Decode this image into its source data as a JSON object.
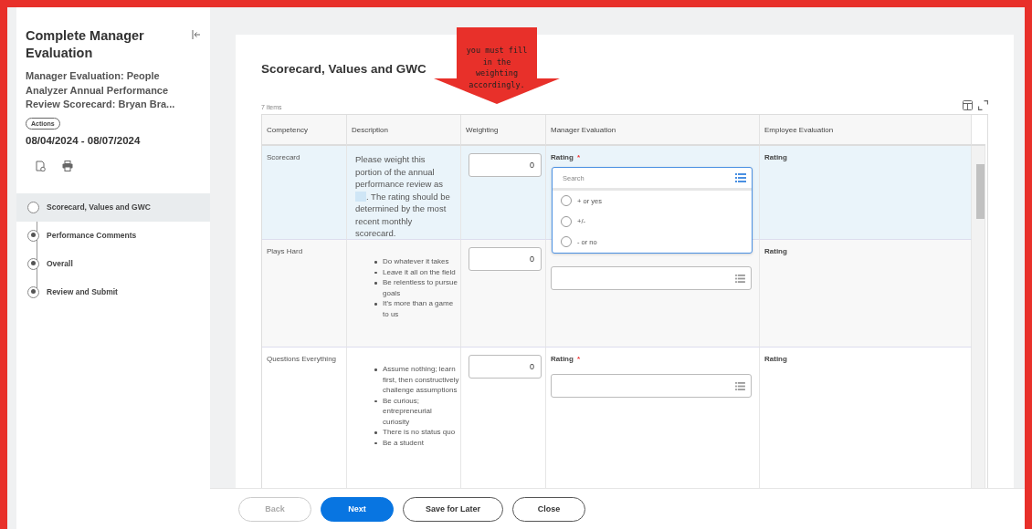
{
  "sidebar": {
    "title": "Complete Manager Evaluation",
    "subtitle": "Manager Evaluation: People Analyzer Annual Performance Review Scorecard: Bryan Bra...",
    "actions_button": "Actions",
    "date_range": "08/04/2024 - 08/07/2024",
    "steps": [
      {
        "label": "Scorecard, Values and GWC",
        "selected": true
      },
      {
        "label": "Performance Comments",
        "selected": false
      },
      {
        "label": "Overall",
        "selected": false
      },
      {
        "label": "Review and Submit",
        "selected": false
      }
    ]
  },
  "card": {
    "title": "Scorecard, Values and GWC",
    "item_count": "7 items",
    "table": {
      "columns": [
        "Competency",
        "Description",
        "Weighting",
        "Manager Evaluation",
        "Employee Evaluation"
      ],
      "rows": [
        {
          "kind": "text",
          "selected": true,
          "competency": "Scorecard",
          "description": [
            "Please weight this portion of the annual performance review as",
            ". The rating should be determined by the most recent monthly scorecard."
          ],
          "weighting": "0",
          "manager_label": "Rating",
          "required_mark": "*",
          "employee_label": "Rating"
        },
        {
          "kind": "bullets",
          "selected": false,
          "competency": "Plays Hard",
          "bullets": [
            "Do whatever it takes",
            "Leave it all on the field",
            "Be relentless to pursue goals",
            "It's more than a game to us"
          ],
          "weighting": "0",
          "employee_label": "Rating"
        },
        {
          "kind": "bullets",
          "selected": false,
          "competency": "Questions Everything",
          "bullets": [
            "Assume nothing; learn first, then constructively challenge assumptions",
            "Be curious; entrepreneurial curiosity",
            "There is no status quo",
            "Be a student"
          ],
          "weighting": "0",
          "manager_label": "Rating",
          "required_mark": "*",
          "employee_label": "Rating"
        }
      ]
    },
    "dropdown": {
      "placeholder": "Search",
      "options": [
        {
          "label": "+ or yes",
          "selected": false
        },
        {
          "label": "+/-",
          "selected": false
        },
        {
          "label": "- or no",
          "selected": false
        }
      ]
    }
  },
  "annotation": {
    "text": "you must fill in the weighting accordingly."
  },
  "footer": {
    "buttons": [
      {
        "label": "Back",
        "kind": "secondary",
        "disabled": true
      },
      {
        "label": "Next",
        "kind": "primary",
        "disabled": false
      },
      {
        "label": "Save for Later",
        "kind": "secondary",
        "disabled": false
      },
      {
        "label": "Close",
        "kind": "secondary",
        "disabled": false
      }
    ]
  }
}
